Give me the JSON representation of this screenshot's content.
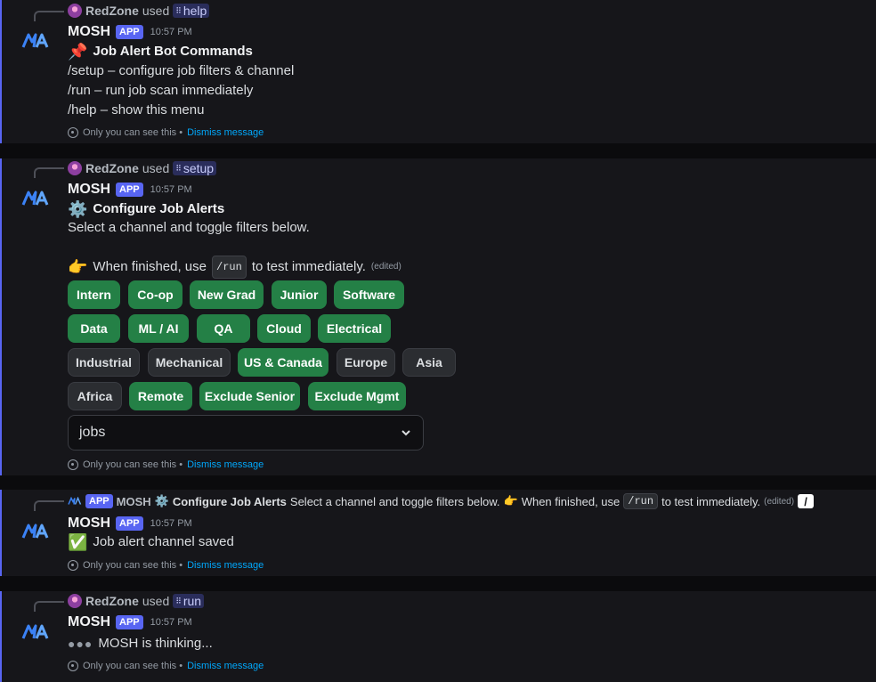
{
  "messages": [
    {
      "reply": {
        "user": "RedZone",
        "verb": "used",
        "command": "help"
      },
      "bot": "MOSH",
      "tag": "APP",
      "time": "10:57 PM",
      "title": "Job Alert Bot Commands",
      "lines": [
        "/setup – configure job filters & channel",
        "/run – run job scan immediately",
        "/help – show this menu"
      ],
      "footer": {
        "text": "Only you can see this •",
        "dismiss": "Dismiss message"
      }
    },
    {
      "reply": {
        "user": "RedZone",
        "verb": "used",
        "command": "setup"
      },
      "bot": "MOSH",
      "tag": "APP",
      "time": "10:57 PM",
      "title": "Configure Job Alerts",
      "line1": "Select a channel and toggle filters below.",
      "line2_a": "When finished, use",
      "line2_code": "/run",
      "line2_b": "to test immediately.",
      "edited": "(edited)",
      "buttons": [
        {
          "label": "Intern",
          "on": true
        },
        {
          "label": "Co-op",
          "on": true
        },
        {
          "label": "New Grad",
          "on": true
        },
        {
          "label": "Junior",
          "on": true
        },
        {
          "label": "Software",
          "on": true
        },
        {
          "label": "Data",
          "on": true
        },
        {
          "label": "ML / AI",
          "on": true
        },
        {
          "label": "QA",
          "on": true
        },
        {
          "label": "Cloud",
          "on": true
        },
        {
          "label": "Electrical",
          "on": true
        },
        {
          "label": "Industrial",
          "on": false
        },
        {
          "label": "Mechanical",
          "on": false
        },
        {
          "label": "US & Canada",
          "on": true
        },
        {
          "label": "Europe",
          "on": false
        },
        {
          "label": "Asia",
          "on": false
        },
        {
          "label": "Africa",
          "on": false
        },
        {
          "label": "Remote",
          "on": true
        },
        {
          "label": "Exclude Senior",
          "on": true
        },
        {
          "label": "Exclude Mgmt",
          "on": true
        }
      ],
      "select_value": "jobs",
      "footer": {
        "text": "Only you can see this •",
        "dismiss": "Dismiss message"
      }
    },
    {
      "reply": {
        "tag": "APP",
        "bot": "MOSH",
        "title": "Configure Job Alerts",
        "text_a": "Select a channel and toggle filters below.",
        "text_b": "When finished, use",
        "code": "/run",
        "text_c": "to test immediately.",
        "edited": "(edited)"
      },
      "bot": "MOSH",
      "tag": "APP",
      "time": "10:57 PM",
      "text": "Job alert channel saved",
      "footer": {
        "text": "Only you can see this •",
        "dismiss": "Dismiss message"
      }
    },
    {
      "reply": {
        "user": "RedZone",
        "verb": "used",
        "command": "run"
      },
      "bot": "MOSH",
      "tag": "APP",
      "time": "10:57 PM",
      "text": "MOSH is thinking...",
      "footer": {
        "text": "Only you can see this •",
        "dismiss": "Dismiss message"
      }
    }
  ],
  "colors": {
    "accent": "#5865f2",
    "toggle_on": "#248046",
    "toggle_off": "#2b2d31",
    "link": "#00a8fc"
  },
  "icons": [
    "mosh-logo-icon",
    "pushpin-icon",
    "gear-icon",
    "pointing-hand-icon",
    "check-icon",
    "eye-icon",
    "chevron-down-icon",
    "pencil-icon",
    "slash-command-icon"
  ]
}
